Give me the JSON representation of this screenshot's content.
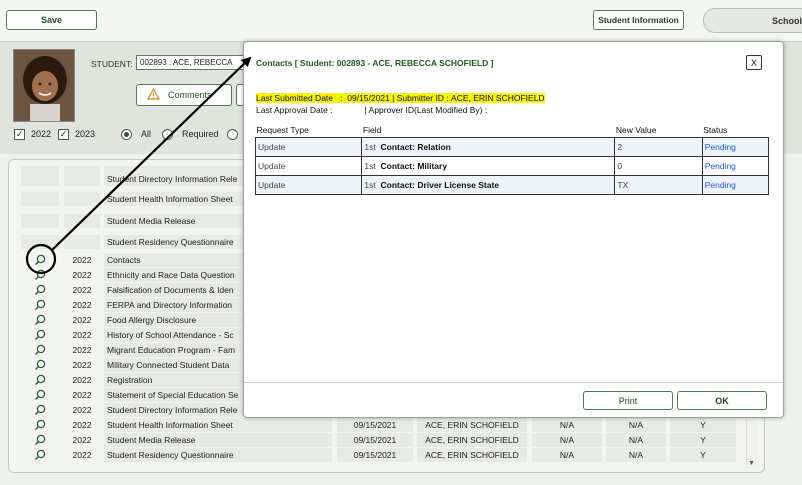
{
  "toolbar": {
    "save_label": "Save",
    "student_info_label": "Student Information",
    "school_tab_label": "School"
  },
  "student": {
    "label": "STUDENT:",
    "selected": "002893 : ACE, REBECCA",
    "comments_label": "Comments"
  },
  "filters": {
    "year1": "2022",
    "year2": "2023",
    "all_label": "All",
    "required_label": "Required"
  },
  "forms": [
    {
      "year": "",
      "name": "Student Directory Information Rele",
      "date": "",
      "submitter": "",
      "na1": "",
      "na2": "",
      "y": ""
    },
    {
      "year": "",
      "name": "Student Health Information Sheet",
      "date": "",
      "submitter": "",
      "na1": "",
      "na2": "",
      "y": ""
    },
    {
      "year": "",
      "name": "Student Media Release",
      "date": "",
      "submitter": "",
      "na1": "",
      "na2": "",
      "y": ""
    },
    {
      "year": "",
      "name": "Student Residency Questionnaire",
      "date": "",
      "submitter": "",
      "na1": "",
      "na2": "",
      "y": ""
    },
    {
      "year": "2022",
      "name": "Contacts",
      "date": "",
      "submitter": "",
      "na1": "",
      "na2": "",
      "y": ""
    },
    {
      "year": "2022",
      "name": "Ethnicity and Race Data Question",
      "date": "",
      "submitter": "",
      "na1": "",
      "na2": "",
      "y": ""
    },
    {
      "year": "2022",
      "name": "Falsification of Documents & Iden",
      "date": "",
      "submitter": "",
      "na1": "",
      "na2": "",
      "y": ""
    },
    {
      "year": "2022",
      "name": "FERPA and Directory Information",
      "date": "",
      "submitter": "",
      "na1": "",
      "na2": "",
      "y": ""
    },
    {
      "year": "2022",
      "name": "Food Allergy Disclosure",
      "date": "",
      "submitter": "",
      "na1": "",
      "na2": "",
      "y": ""
    },
    {
      "year": "2022",
      "name": "History of School Attendance - Sc",
      "date": "",
      "submitter": "",
      "na1": "",
      "na2": "",
      "y": ""
    },
    {
      "year": "2022",
      "name": "Migrant Education Program - Fam",
      "date": "",
      "submitter": "",
      "na1": "",
      "na2": "",
      "y": ""
    },
    {
      "year": "2022",
      "name": "Military Connected Student Data",
      "date": "",
      "submitter": "",
      "na1": "",
      "na2": "",
      "y": ""
    },
    {
      "year": "2022",
      "name": "Registration",
      "date": "",
      "submitter": "",
      "na1": "",
      "na2": "",
      "y": ""
    },
    {
      "year": "2022",
      "name": "Statement of Special Education Se",
      "date": "",
      "submitter": "",
      "na1": "",
      "na2": "",
      "y": ""
    },
    {
      "year": "2022",
      "name": "Student Directory Information Rele",
      "date": "",
      "submitter": "",
      "na1": "",
      "na2": "",
      "y": ""
    },
    {
      "year": "2022",
      "name": "Student Health Information Sheet",
      "date": "09/15/2021",
      "submitter": "ACE, ERIN SCHOFIELD",
      "na1": "N/A",
      "na2": "N/A",
      "y": "Y"
    },
    {
      "year": "2022",
      "name": "Student Media Release",
      "date": "09/15/2021",
      "submitter": "ACE, ERIN SCHOFIELD",
      "na1": "N/A",
      "na2": "N/A",
      "y": "Y"
    },
    {
      "year": "2022",
      "name": "Student Residency Questionnaire",
      "date": "09/15/2021",
      "submitter": "ACE, ERIN SCHOFIELD",
      "na1": "N/A",
      "na2": "N/A",
      "y": "Y"
    }
  ],
  "modal": {
    "title": "Contacts [ Student: 002893 - ACE, REBECCA SCHOFIELD ]",
    "close_label": "X",
    "last_submitted_label": "Last Submitted Date",
    "last_submitted_sep": ":",
    "last_submitted_value": "09/15/2021",
    "submitter_label": "| Submitter ID :",
    "submitter_value": "ACE, ERIN SCHOFIELD",
    "last_approval_label": "Last Approval Date :",
    "approver_label": "| Approver  ID(Last Modified By) :",
    "columns": {
      "request_type": "Request Type",
      "field": "Field",
      "new_value": "New Value",
      "status": "Status"
    },
    "rows": [
      {
        "request_type": "Update",
        "field_prefix": "1st",
        "field": "Contact: Relation",
        "new_value": "2",
        "status": "Pending"
      },
      {
        "request_type": "Update",
        "field_prefix": "1st",
        "field": "Contact: Military",
        "new_value": "0",
        "status": "Pending"
      },
      {
        "request_type": "Update",
        "field_prefix": "1st",
        "field": "Contact: Driver License State",
        "new_value": "TX",
        "status": "Pending"
      }
    ],
    "print_label": "Print",
    "ok_label": "OK"
  },
  "colors": {
    "accent": "#1d5a1d",
    "highlight": "#f7f20a",
    "status_link": "#2255dd"
  }
}
